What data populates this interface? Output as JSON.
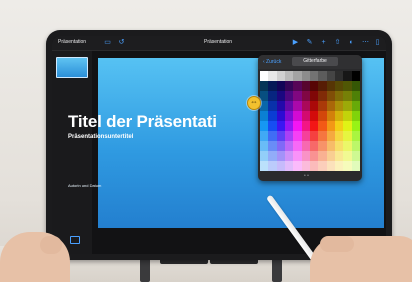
{
  "toolbar": {
    "left_label": "Präsentation",
    "center_label": "Präsentation"
  },
  "slide": {
    "title": "Titel der Präsentati",
    "subtitle": "Präsentationsuntertitel",
    "author_line": "Autorin und Datum"
  },
  "color_picker": {
    "back_label": "‹ Zurück",
    "title": "Gitterfarbe",
    "page_indicator": "• •",
    "columns": [
      {
        "hue": 205
      },
      {
        "hue": 225
      },
      {
        "hue": 250
      },
      {
        "hue": 275
      },
      {
        "hue": 300
      },
      {
        "hue": 330
      },
      {
        "hue": 0
      },
      {
        "hue": 18
      },
      {
        "hue": 35
      },
      {
        "hue": 50
      },
      {
        "hue": 65
      },
      {
        "hue": 85
      }
    ]
  }
}
